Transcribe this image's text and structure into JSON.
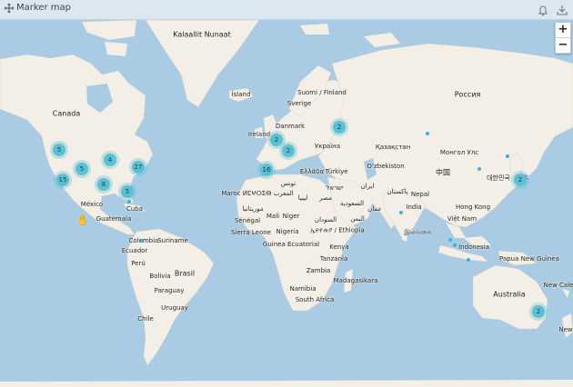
{
  "header": {
    "title": "Marker map",
    "icons": [
      "move-icon",
      "bell-icon",
      "download-icon"
    ]
  },
  "zoom": {
    "in_label": "+",
    "out_label": "−"
  },
  "labels": {
    "kalaallit": "Kalaallit Nunaat",
    "island": "Ísland",
    "suomi": "Suomi / Finland",
    "sverige": "Sverige",
    "russia": "Россия",
    "canada": "Canada",
    "ireland": "Ireland",
    "danmark": "Danmark",
    "ukraine": "Україна",
    "kazakhstan": "Қазақстан",
    "mongolia": "Монгол Улс",
    "ozbekiston": "O‘zbekiston",
    "greece": "Ελλάδα",
    "turkey": "Türkiye",
    "china": "中国",
    "korea": "대한민국",
    "japan": "日本",
    "tunisia": "تونس",
    "israel": "ישראל",
    "iran": "ایران",
    "pakistan": "پاکستان",
    "nepal": "Nepal",
    "maroc": "Maroc ⵍⵎⵖⵔⵉⴱ المغرب",
    "libya": "ليبيا",
    "egypt": "مصر",
    "saudi": "السعودية",
    "oman": "عمان",
    "india": "India",
    "hongkong": "Hong Kong",
    "mexico": "México",
    "cuba": "Cuba",
    "mauritania": "موريتانيا",
    "mali": "Mali",
    "niger": "Niger",
    "sudan": "السودان",
    "yemen": "اليمن",
    "vietnam": "Việt Nam",
    "guatemala": "Guatemala",
    "senegal": "Sénégal",
    "sierra": "Sierra Leone",
    "nigeria": "Nigeria",
    "ethiopia": "ኢትዮጵያ / Ethiopia",
    "srilanka": "இலங்கை",
    "colombia": "Colombia",
    "suriname": "Suriname",
    "kenya": "Kenya",
    "indonesia": "Indonesia",
    "ecuador": "Ecuador",
    "guinea_eq": "Guinea Ecuatorial",
    "tanzania": "Tanzania",
    "peru": "Perú",
    "brasil": "Brasil",
    "png": "Papua New Guinea",
    "bolivia": "Bolivia",
    "zambia": "Zambia",
    "madagascar": "Madagasikara",
    "paraguay": "Paraguay",
    "namibia": "Namibia",
    "australia": "Australia",
    "uruguay": "Uruguay",
    "southafrica": "South Africa",
    "chile": "Chile",
    "newcal": "New Cale",
    "newzealand": "New"
  },
  "clusters": [
    {
      "id": "uk",
      "count": "2"
    },
    {
      "id": "europe",
      "count": "2"
    },
    {
      "id": "moscow",
      "count": "2"
    },
    {
      "id": "med",
      "count": "16"
    },
    {
      "id": "usw",
      "count": "5"
    },
    {
      "id": "usmw",
      "count": "4"
    },
    {
      "id": "usne",
      "count": "27"
    },
    {
      "id": "usrock",
      "count": "5"
    },
    {
      "id": "usca",
      "count": "15"
    },
    {
      "id": "ustx",
      "count": "8"
    },
    {
      "id": "usfl",
      "count": "5"
    },
    {
      "id": "japan",
      "count": "2"
    },
    {
      "id": "aus",
      "count": "2"
    }
  ],
  "colors": {
    "water": "#a9cbe3",
    "land": "#f3efe6",
    "cluster": "#5bc0d4"
  }
}
